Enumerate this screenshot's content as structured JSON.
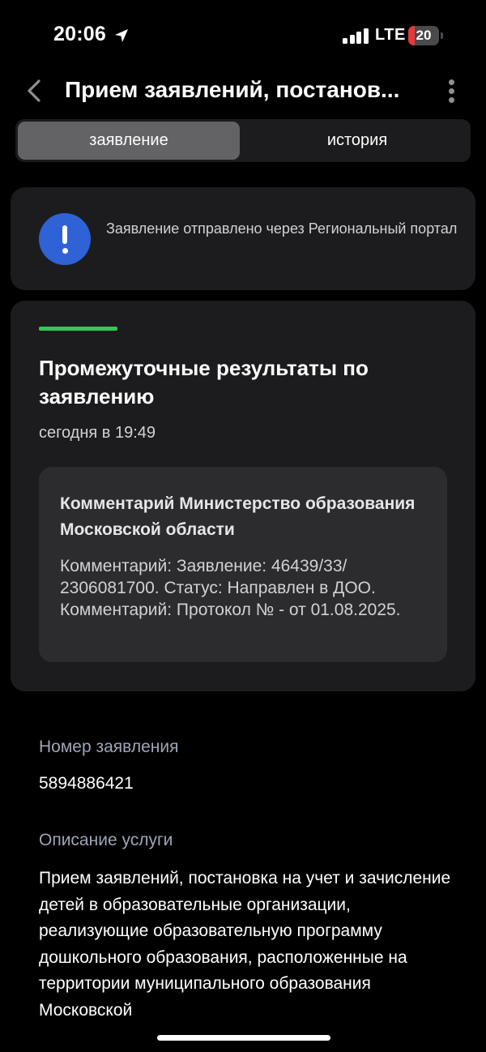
{
  "status_bar": {
    "time": "20:06",
    "network": "LTE",
    "battery_level": "20",
    "battery_fraction": 0.2,
    "battery_color": "#e5393d"
  },
  "nav": {
    "title": "Прием заявлений, постанов...",
    "back_icon": "chevron-left-icon",
    "more_icon": "more-vertical-icon"
  },
  "tabs": [
    {
      "label": "заявление",
      "active": true
    },
    {
      "label": "история",
      "active": false
    }
  ],
  "info_banner": {
    "icon": "exclamation-icon",
    "text": "Заявление отправлено через Региональный портал",
    "icon_color": "#2e62d6"
  },
  "result_card": {
    "accent_color": "#34c759",
    "title": "Промежуточные результаты по заявлению",
    "timestamp": "сегодня в 19:49",
    "comment": {
      "title": "Комментарий Министерство образования Московской области",
      "body": "Комментарий: Заявление: 46439/33/ 2306081700. Статус: Направлен в ДОО. Комментарий: Протокол № - от 01.08.2025."
    }
  },
  "details": {
    "application_number_label": "Номер заявления",
    "application_number_value": "5894886421",
    "service_description_label": "Описание услуги",
    "service_description_value": "Прием заявлений, постановка на учет и зачисление детей в образовательные организации, реализующие образовательную программу дошкольного образования, расположенные на территории муниципального образования Московской"
  }
}
